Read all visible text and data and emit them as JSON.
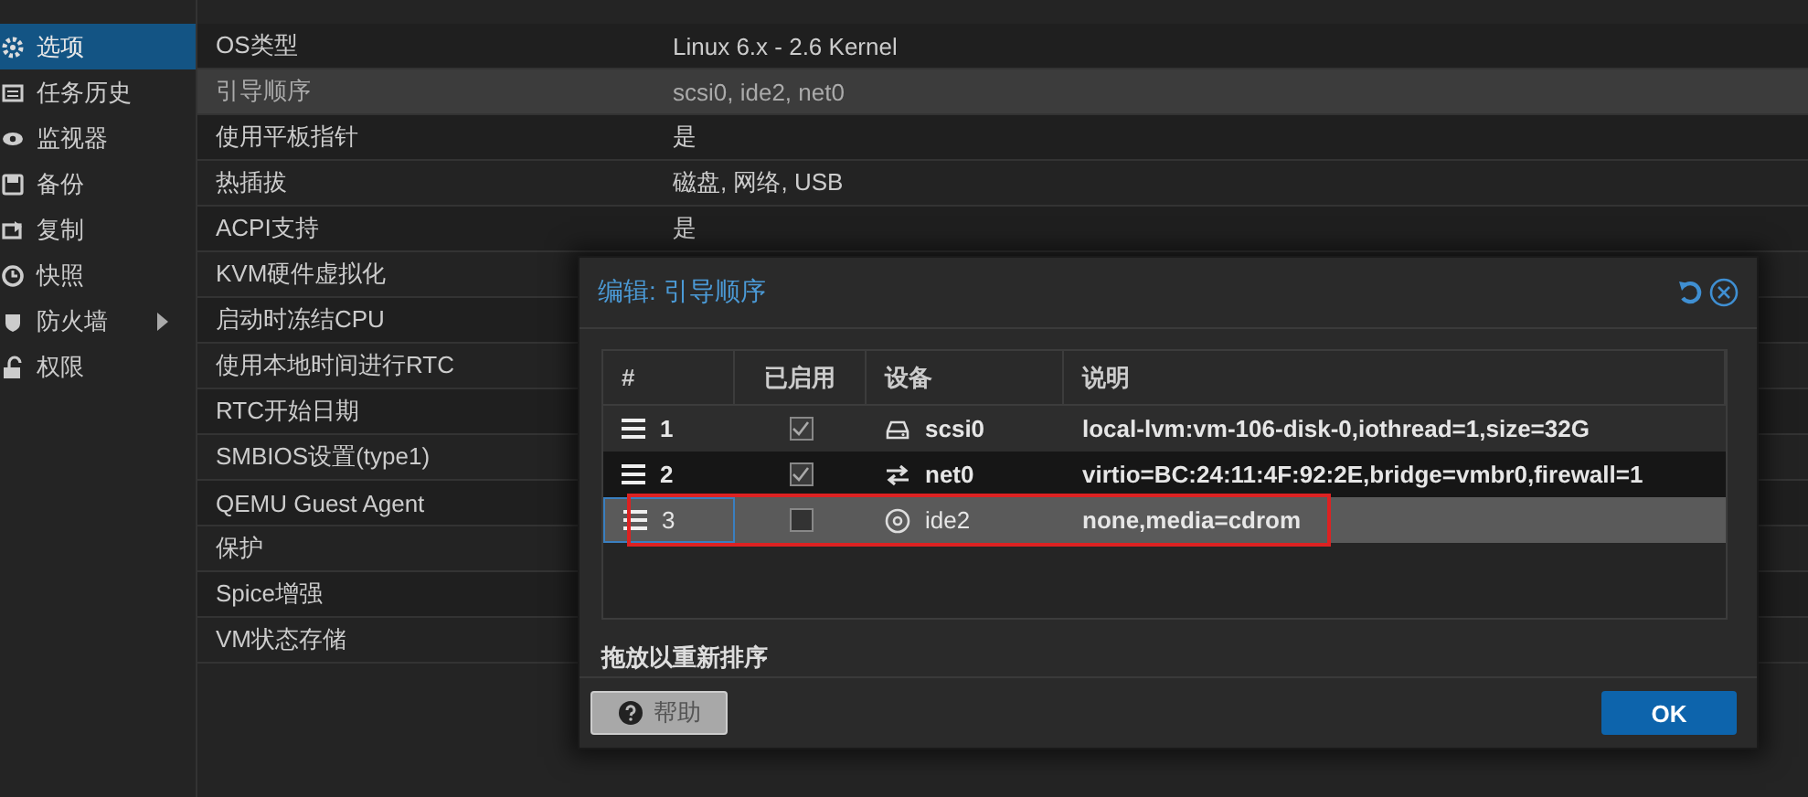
{
  "sidebar": {
    "items": [
      {
        "label": "选项",
        "selected": true,
        "expandable": false
      },
      {
        "label": "任务历史",
        "selected": false,
        "expandable": false
      },
      {
        "label": "监视器",
        "selected": false,
        "expandable": false
      },
      {
        "label": "备份",
        "selected": false,
        "expandable": false
      },
      {
        "label": "复制",
        "selected": false,
        "expandable": false
      },
      {
        "label": "快照",
        "selected": false,
        "expandable": false
      },
      {
        "label": "防火墙",
        "selected": false,
        "expandable": true
      },
      {
        "label": "权限",
        "selected": false,
        "expandable": false
      }
    ]
  },
  "options": {
    "rows": [
      {
        "name": "OS类型",
        "value": "Linux 6.x - 2.6 Kernel",
        "selected": false
      },
      {
        "name": "引导顺序",
        "value": "scsi0, ide2, net0",
        "selected": true
      },
      {
        "name": "使用平板指针",
        "value": "是",
        "selected": false
      },
      {
        "name": "热插拔",
        "value": "磁盘, 网络, USB",
        "selected": false
      },
      {
        "name": "ACPI支持",
        "value": "是",
        "selected": false
      },
      {
        "name": "KVM硬件虚拟化",
        "selected": false
      },
      {
        "name": "启动时冻结CPU",
        "selected": false
      },
      {
        "name": "使用本地时间进行RTC",
        "selected": false
      },
      {
        "name": "RTC开始日期",
        "selected": false
      },
      {
        "name": "SMBIOS设置(type1)",
        "selected": false
      },
      {
        "name": "QEMU Guest Agent",
        "selected": false
      },
      {
        "name": "保护",
        "selected": false
      },
      {
        "name": "Spice增强",
        "selected": false
      },
      {
        "name": "VM状态存储",
        "selected": false
      }
    ]
  },
  "dialog": {
    "title": "编辑: 引导顺序",
    "columns": [
      "#",
      "已启用",
      "设备",
      "说明"
    ],
    "rows": [
      {
        "number": "1",
        "enabled": true,
        "kind": "disk",
        "device": "scsi0",
        "description": "local-lvm:vm-106-disk-0,iothread=1,size=32G",
        "selected": false
      },
      {
        "number": "2",
        "enabled": true,
        "kind": "network",
        "device": "net0",
        "description": "virtio=BC:24:11:4F:92:2E,bridge=vmbr0,firewall=1",
        "selected": false
      },
      {
        "number": "3",
        "enabled": false,
        "kind": "cdrom",
        "device": "ide2",
        "description": "none,media=cdrom",
        "selected": true
      }
    ],
    "hint": "拖放以重新排序",
    "help_button": "帮助",
    "ok_button": "OK"
  }
}
